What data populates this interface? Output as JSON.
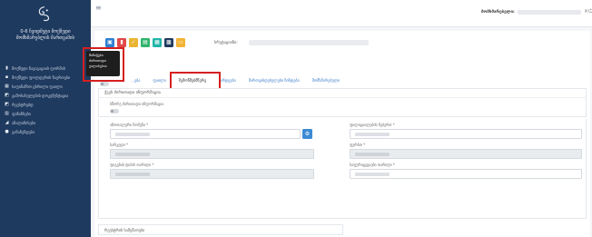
{
  "sidebar": {
    "org_name_line1": "0-6 ჩვიდმეტი მოქმედი",
    "org_name_line2": "მომხმარებლის მართვამის",
    "items": [
      {
        "label": "მოქმედი ნავიგაციის ფორმის",
        "icon": "file-icon"
      },
      {
        "label": "მოქმედი ფოლდერის ნაერთები",
        "icon": "folder-icon"
      },
      {
        "label": "საფინანსო ცხრილი ფაილი",
        "icon": "table-icon"
      },
      {
        "label": "გამოსახულების დოკუმენტაცია",
        "icon": "document-icon"
      },
      {
        "label": "რეესტრებდ",
        "icon": "book-icon"
      },
      {
        "label": "ფინანსები",
        "icon": "chart-icon"
      },
      {
        "label": "ანალიზისები",
        "icon": "bar-chart-icon"
      },
      {
        "label": "განაჩენდება",
        "icon": "gear-icon"
      }
    ]
  },
  "topbar": {
    "user_label": "მომხმარებელი:",
    "icon_close": "×",
    "icon_power": "⏻"
  },
  "toolbar": {
    "record_label": "სრუტაციინი:"
  },
  "tooltip": {
    "line1": "მინიჭები",
    "line2": "ძირითადი",
    "line3": "ვალისებია"
  },
  "tabs": [
    {
      "label": "...ება"
    },
    {
      "label": "ფაილი"
    },
    {
      "label": "შემოწმებმწერვ"
    },
    {
      "label": "ვინდეები"
    },
    {
      "label": "მართვისდებულები ზინდები"
    },
    {
      "label": "მომხმარებელი"
    }
  ],
  "sections": {
    "main_title": "ქვეს ძირითადი ინფორმაცია",
    "toggle_label": "სწორე ძირითადი ინფორმაცია",
    "fields": {
      "field1_label": "ანოთალური ნომენი *",
      "field2_label": "ფილიციალების ნებერთ *",
      "field3_label": "სარკედი *",
      "field4_label": "ფურბთ *",
      "field5_label": "ფიგების ტიპის თარიღი *",
      "field6_label": "საფურიცეციები თარიღი *"
    },
    "bottom_title": "რეესტრის სამუშაოები"
  }
}
